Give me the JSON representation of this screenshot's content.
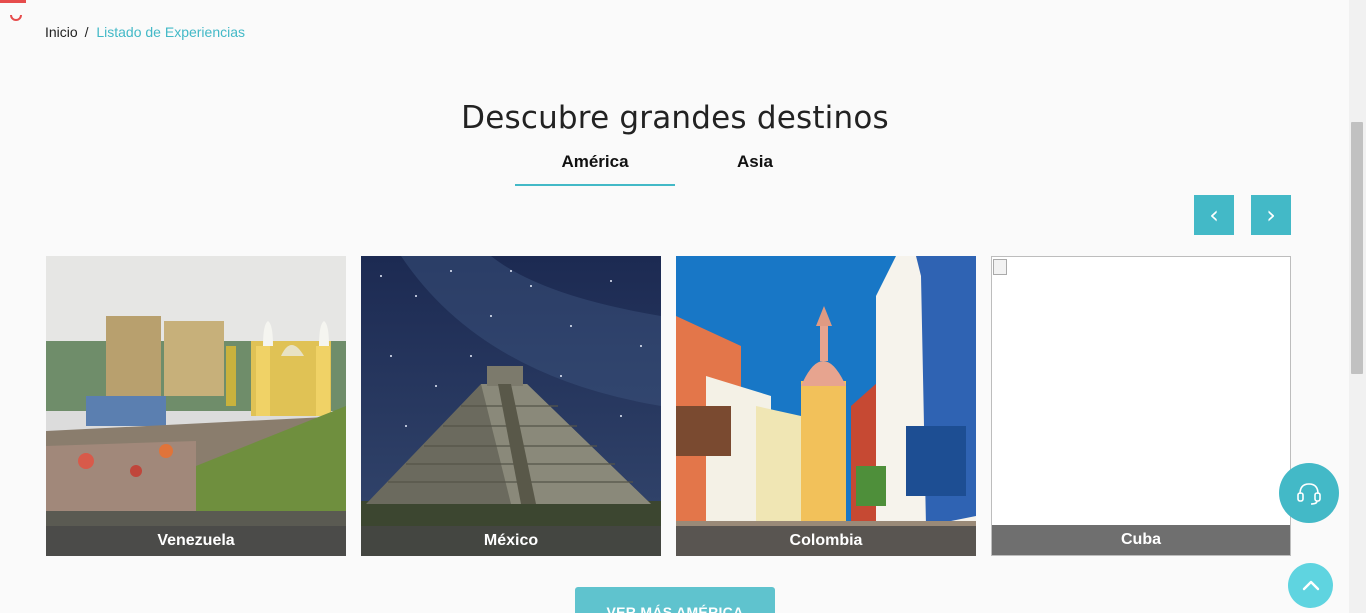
{
  "breadcrumb": {
    "home": "Inicio",
    "separator": "/",
    "current": "Listado de Experiencias"
  },
  "section": {
    "title": "Descubre grandes destinos"
  },
  "tabs": [
    {
      "label": "América",
      "active": true
    },
    {
      "label": "Asia",
      "active": false
    }
  ],
  "carousel": {
    "prev_label": "‹",
    "next_label": "›"
  },
  "destinations": [
    {
      "name": "Venezuela"
    },
    {
      "name": "México"
    },
    {
      "name": "Colombia"
    },
    {
      "name": "Cuba"
    }
  ],
  "more_button": {
    "label": "VER MÁS AMÉRICA"
  },
  "colors": {
    "accent": "#43b9c7",
    "loader": "#e64c4c"
  },
  "icons": {
    "chat": "headset-icon",
    "scroll_top": "chevron-up-icon",
    "loading": "spinner-icon"
  }
}
